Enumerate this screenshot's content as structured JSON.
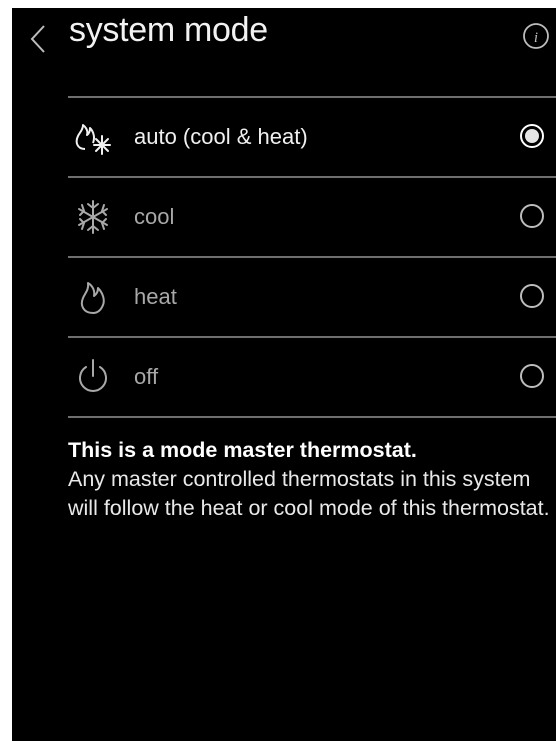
{
  "header": {
    "title": "system mode",
    "back_icon": "chevron-left-icon",
    "info_icon": "info-icon"
  },
  "modes": [
    {
      "label": "auto (cool & heat)",
      "icon": "auto-flame-snowflake-icon",
      "selected": true
    },
    {
      "label": "cool",
      "icon": "snowflake-icon",
      "selected": false
    },
    {
      "label": "heat",
      "icon": "flame-icon",
      "selected": false
    },
    {
      "label": "off",
      "icon": "power-icon",
      "selected": false
    }
  ],
  "note": {
    "heading": "This is a mode master thermostat.",
    "body": "Any master controlled thermostats in this system will follow the heat or cool mode of this thermostat."
  },
  "colors": {
    "background": "#000000",
    "text": "#ffffff",
    "divider": "#6f6f6f",
    "dim_text": "#a8a8a8"
  }
}
